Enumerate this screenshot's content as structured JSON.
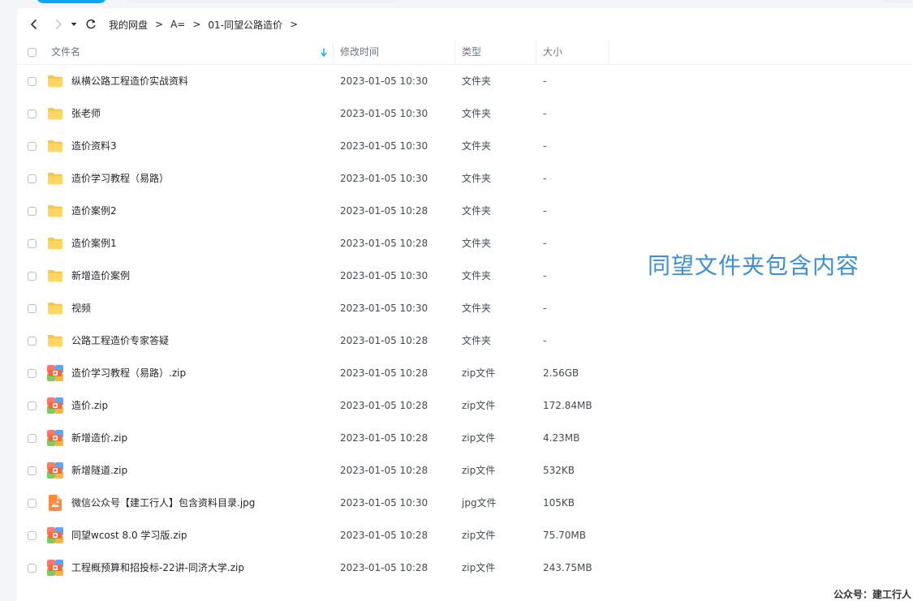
{
  "breadcrumb": [
    "我的网盘",
    "A=",
    "01-同望公路造价"
  ],
  "breadcrumb_separator": ">",
  "columns": {
    "name": "文件名",
    "modified": "修改时间",
    "type": "类型",
    "size": "大小"
  },
  "files": [
    {
      "name": "纵横公路工程造价实战资料",
      "modified": "2023-01-05 10:30",
      "type": "文件夹",
      "size": "-",
      "icon": "folder-icon"
    },
    {
      "name": "张老师",
      "modified": "2023-01-05 10:30",
      "type": "文件夹",
      "size": "-",
      "icon": "folder-icon"
    },
    {
      "name": "造价资料3",
      "modified": "2023-01-05 10:30",
      "type": "文件夹",
      "size": "-",
      "icon": "folder-icon"
    },
    {
      "name": "造价学习教程（易路）",
      "modified": "2023-01-05 10:30",
      "type": "文件夹",
      "size": "-",
      "icon": "folder-icon"
    },
    {
      "name": "造价案例2",
      "modified": "2023-01-05 10:28",
      "type": "文件夹",
      "size": "-",
      "icon": "folder-icon"
    },
    {
      "name": "造价案例1",
      "modified": "2023-01-05 10:28",
      "type": "文件夹",
      "size": "-",
      "icon": "folder-icon"
    },
    {
      "name": "新增造价案例",
      "modified": "2023-01-05 10:30",
      "type": "文件夹",
      "size": "-",
      "icon": "folder-icon"
    },
    {
      "name": "视频",
      "modified": "2023-01-05 10:30",
      "type": "文件夹",
      "size": "-",
      "icon": "folder-icon"
    },
    {
      "name": "公路工程造价专家答疑",
      "modified": "2023-01-05 10:28",
      "type": "文件夹",
      "size": "-",
      "icon": "folder-icon"
    },
    {
      "name": "造价学习教程（易路）.zip",
      "modified": "2023-01-05 10:28",
      "type": "zip文件",
      "size": "2.56GB",
      "icon": "zip-icon"
    },
    {
      "name": "造价.zip",
      "modified": "2023-01-05 10:28",
      "type": "zip文件",
      "size": "172.84MB",
      "icon": "zip-icon"
    },
    {
      "name": "新增造价.zip",
      "modified": "2023-01-05 10:28",
      "type": "zip文件",
      "size": "4.23MB",
      "icon": "zip-icon"
    },
    {
      "name": "新增隧道.zip",
      "modified": "2023-01-05 10:28",
      "type": "zip文件",
      "size": "532KB",
      "icon": "zip-icon"
    },
    {
      "name": "微信公众号【建工行人】包含资料目录.jpg",
      "modified": "2023-01-05 10:30",
      "type": "jpg文件",
      "size": "105KB",
      "icon": "image-icon"
    },
    {
      "name": "同望wcost  8.0 学习版.zip",
      "modified": "2023-01-05 10:28",
      "type": "zip文件",
      "size": "75.70MB",
      "icon": "zip-icon"
    },
    {
      "name": "工程概预算和招投标-22讲-同济大学.zip",
      "modified": "2023-01-05 10:28",
      "type": "zip文件",
      "size": "243.75MB",
      "icon": "zip-icon"
    }
  ],
  "annotation": "同望文件夹包含内容",
  "watermark": "公众号：建工行人",
  "colors": {
    "accent": "#06a7ff",
    "folder": "#ffc53d",
    "annotation": "#3b8fd9"
  }
}
